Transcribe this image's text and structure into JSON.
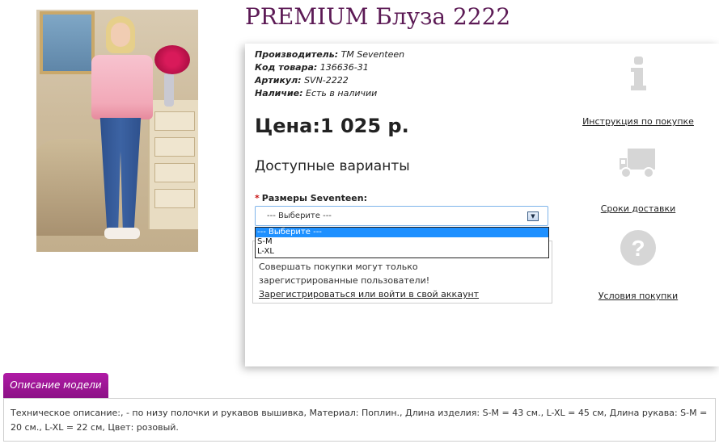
{
  "product": {
    "title": "PREMIUM Блуза 2222",
    "image_alt": "Модель в розовой блузе и джинсах"
  },
  "meta": {
    "manufacturer_label": "Производитель:",
    "manufacturer_value": "TM Seventeen",
    "code_label": "Код товара:",
    "code_value": "136636-31",
    "article_label": "Артикул:",
    "article_value": "SVN-2222",
    "stock_label": "Наличие:",
    "stock_value": "Есть в наличии"
  },
  "price": "Цена:1 025 р.",
  "variants": {
    "heading": "Доступные варианты",
    "required_mark": "*",
    "size_label": "Размеры Seventeen:",
    "selected": "--- Выберите ---",
    "options": [
      "--- Выберите ---",
      "S-M",
      "L-XL"
    ]
  },
  "notice": {
    "message": "Совершать покупки могут только зарегистрированные пользователи!",
    "link": "Зарегистрироваться или войти в свой аккаунт"
  },
  "side_links": [
    {
      "icon": "info-icon",
      "label": "Инструкция по покупке"
    },
    {
      "icon": "truck-icon",
      "label": "Сроки доставки"
    },
    {
      "icon": "question-icon",
      "label": "Условия покупки"
    }
  ],
  "tabs": {
    "description_tab": "Описание модели"
  },
  "description": "Техническое описание:, - по низу полочки и рукавов вышивка, Материал: Поплин., Длина изделия: S-M = 43 см., L-XL = 45 см, Длина рукава: S-M = 20 см., L-XL = 22 см, Цвет: розовый.",
  "colors": {
    "title": "#5c1a55",
    "tab": "#9c1895",
    "highlight": "#1e90ff",
    "icon_gray": "#d6d6d6"
  }
}
